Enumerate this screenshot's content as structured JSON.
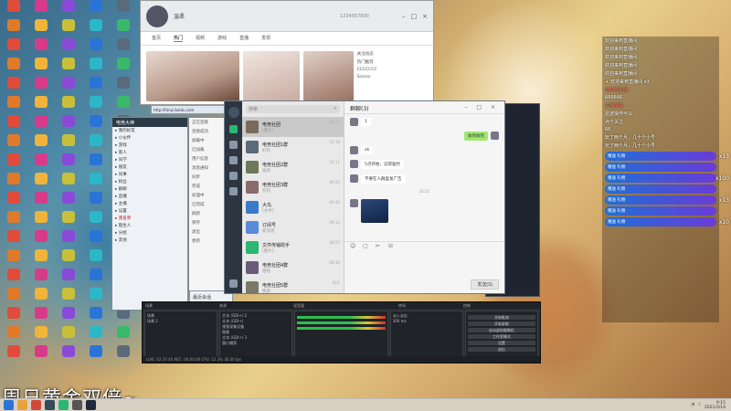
{
  "caption": "周日黄金双倍~",
  "browser": {
    "title": "温柔",
    "subtitle": "1234567890",
    "tabs": [
      "首页",
      "热门",
      "视频",
      "游戏",
      "直播",
      "发现"
    ],
    "side_items": [
      "关注动态",
      "热门推荐",
      "CCCCCCC",
      "Ssssss"
    ]
  },
  "url_text": "http://fanyi.baidu.com",
  "chatlist": {
    "header": "电竞大神",
    "groups": [
      "▸ 我的好友",
      "▸ 小伙伴",
      "▸ 游戏",
      "▸ 家人",
      "▸ 同学",
      "▸ 朋友",
      "▸ 同事",
      "▸ 粉丝",
      "▸ 群聊",
      "▸ 直播",
      "▸ 主播",
      "▸ 设置",
      "▸ 黑名单",
      "▸ 陌生人",
      "▸ 分组",
      "▸ 其他"
    ]
  },
  "logwin": {
    "rows": [
      "正在连接",
      "连接成功",
      "加载中",
      "已加载",
      "用户信息",
      "消息通知",
      "同步",
      "完成",
      "处理中",
      "已完成",
      "刷新",
      "保存",
      "退出",
      "更新"
    ]
  },
  "messenger": {
    "search_placeholder": "搜索",
    "chat_title": "群聊(3)",
    "send_label": "发送(S)",
    "conversations": [
      {
        "name": "电竞社团",
        "preview": "[图片]",
        "time": "10:21",
        "color": "#7a6a5a"
      },
      {
        "name": "电竞社团1群",
        "preview": "好的",
        "time": "10:18",
        "color": "#5a6a7a"
      },
      {
        "name": "电竞社团2群",
        "preview": "收到",
        "time": "10:11",
        "color": "#6a7a5a"
      },
      {
        "name": "电竞社团3群",
        "preview": "在吗",
        "time": "09:55",
        "color": "#8a6a6a"
      },
      {
        "name": "大鸟",
        "preview": "[文件]",
        "time": "09:40",
        "color": "#3a7ac8"
      },
      {
        "name": "订阅号",
        "preview": "新消息",
        "time": "09:12",
        "color": "#5a8ad8"
      },
      {
        "name": "文件传输助手",
        "preview": "[图片]",
        "time": "08:55",
        "color": "#2bb673"
      },
      {
        "name": "电竞社团4群",
        "preview": "哈哈",
        "time": "08:40",
        "color": "#6a5a7a"
      },
      {
        "name": "电竞社团5群",
        "preview": "晚安",
        "time": "昨天",
        "color": "#7a7a6a"
      },
      {
        "name": "开发者社区",
        "preview": "通知",
        "time": "昨天",
        "color": "#5a5a6a"
      }
    ],
    "messages": [
      {
        "who": "them",
        "text": "1"
      },
      {
        "who": "me",
        "text": "收到收到"
      },
      {
        "who": "them",
        "text": "ok"
      },
      {
        "who": "them",
        "text": "5点开始，记得准时"
      },
      {
        "who": "them",
        "text": "不要在人群里发广告"
      },
      {
        "who": "time",
        "text": "10:21"
      },
      {
        "who": "them-img",
        "text": ""
      }
    ]
  },
  "obs": {
    "scenes_title": "场景",
    "sources_title": "来源",
    "mixer_title": "混音器",
    "transitions_title": "转场",
    "controls_title": "控制",
    "scenes": [
      "场景",
      "场景 2"
    ],
    "sources": [
      "文本 (GDI+) 2",
      "文本 (GDI+)",
      "视频采集设备",
      "图像",
      "文本 (GDI+) 3",
      "窗口捕获"
    ],
    "controls": [
      "开始推流",
      "开始录制",
      "启动虚拟摄像机",
      "工作室模式",
      "设置",
      "退出"
    ],
    "transition": "淡入淡出",
    "duration": "300 ms",
    "status": "LIVE: 02:37:40   REC: 00:00:00   CPU: 12.3%   30.00 fps"
  },
  "livechat": {
    "rows": [
      {
        "name": "",
        "text": "欢迎来到直播间",
        "cls": ""
      },
      {
        "name": "",
        "text": "欢迎来到直播间",
        "cls": ""
      },
      {
        "name": "",
        "text": "欢迎来到直播间",
        "cls": ""
      },
      {
        "name": "",
        "text": "欢迎来到直播间",
        "cls": ""
      },
      {
        "name": "",
        "text": "欢迎来到直播间",
        "cls": ""
      },
      {
        "name": "★",
        "text": "欢迎来到直播间 x3",
        "cls": ""
      },
      {
        "name": "",
        "text": "你好呀主播",
        "cls": "red"
      },
      {
        "name": "",
        "text": "666666",
        "cls": ""
      },
      {
        "name": "",
        "text": "主播加油",
        "cls": "red"
      },
      {
        "name": "",
        "text": "这波操作可以",
        "cls": ""
      },
      {
        "name": "",
        "text": "点个关注",
        "cls": ""
      },
      {
        "name": "",
        "text": "66",
        "cls": ""
      },
      {
        "name": "",
        "text": "玩了两个月，几十个小号",
        "cls": ""
      },
      {
        "name": "",
        "text": "玩了两个月，几十个小号",
        "cls": ""
      }
    ],
    "gifts": [
      {
        "text": "赠送 礼物",
        "count": "x13"
      },
      {
        "text": "赠送 礼物",
        "count": ""
      },
      {
        "text": "赠送 礼物",
        "count": "x100"
      },
      {
        "text": "赠送 礼物",
        "count": ""
      },
      {
        "text": "赠送 礼物",
        "count": "x13"
      },
      {
        "text": "赠送 礼物",
        "count": ""
      },
      {
        "text": "赠送 礼物",
        "count": "x10"
      }
    ]
  },
  "taskbar": {
    "time": "9:15",
    "date": "2021/3/14"
  },
  "smallwin": {
    "text": "最近会话"
  }
}
